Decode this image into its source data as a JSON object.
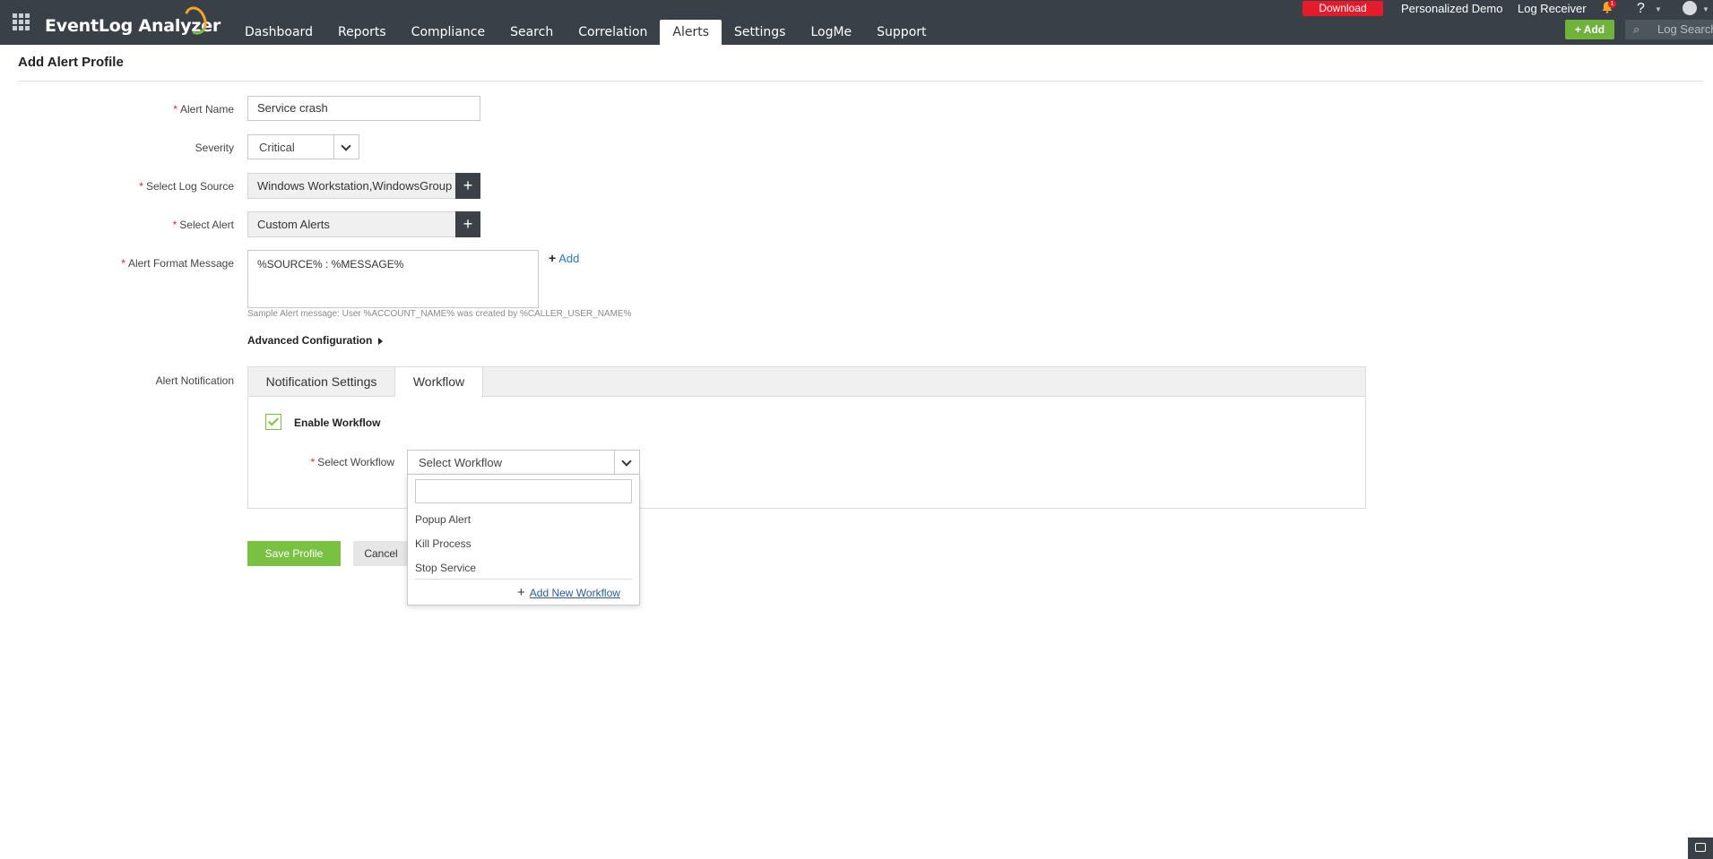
{
  "app": {
    "name": "EventLog Analyzer"
  },
  "nav": {
    "items": [
      {
        "label": "Dashboard"
      },
      {
        "label": "Reports"
      },
      {
        "label": "Compliance"
      },
      {
        "label": "Search"
      },
      {
        "label": "Correlation"
      },
      {
        "label": "Alerts"
      },
      {
        "label": "Settings"
      },
      {
        "label": "LogMe"
      },
      {
        "label": "Support"
      }
    ],
    "active": "Alerts"
  },
  "topbar": {
    "download": "Download",
    "personalized_demo": "Personalized Demo",
    "log_receiver": "Log Receiver",
    "notification_count": "1",
    "help": "?",
    "add": "Add",
    "search_placeholder": "Log Search"
  },
  "page": {
    "title": "Add Alert Profile"
  },
  "form": {
    "alert_name": {
      "label": "Alert Name",
      "value": "Service crash"
    },
    "severity": {
      "label": "Severity",
      "value": "Critical"
    },
    "log_source": {
      "label": "Select Log Source",
      "value": "Windows Workstation,WindowsGroup"
    },
    "select_alert": {
      "label": "Select Alert",
      "value": "Custom Alerts"
    },
    "format_message": {
      "label": "Alert Format Message",
      "value": "%SOURCE% : %MESSAGE%",
      "add_link": "Add"
    },
    "sample_message": "Sample Alert message: User %ACCOUNT_NAME% was created by %CALLER_USER_NAME%",
    "advanced_configuration": "Advanced Configuration",
    "alert_notification_label": "Alert Notification"
  },
  "tabs": {
    "items": [
      {
        "label": "Notification Settings"
      },
      {
        "label": "Workflow"
      }
    ],
    "active": "Workflow"
  },
  "workflow": {
    "enable_label": "Enable Workflow",
    "enabled": true,
    "select_label": "Select Workflow",
    "select_placeholder": "Select Workflow",
    "options": [
      {
        "label": "Popup Alert"
      },
      {
        "label": "Kill Process"
      },
      {
        "label": "Stop Service"
      }
    ],
    "add_new": "Add New Workflow"
  },
  "actions": {
    "save": "Save Profile",
    "cancel": "Cancel"
  },
  "colors": {
    "topbar": "#394048",
    "accent_green": "#7ac143",
    "download_red": "#e41b2a",
    "link_blue": "#2979c2"
  }
}
